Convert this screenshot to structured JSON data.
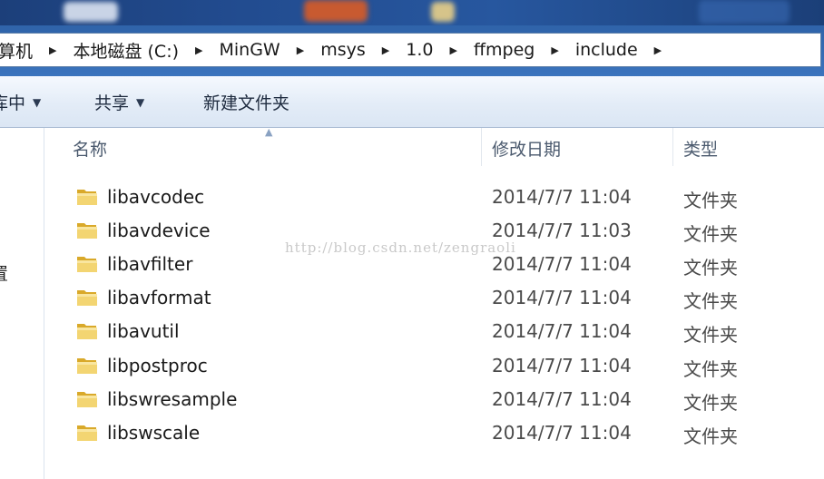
{
  "breadcrumb": {
    "items": [
      "算机",
      "本地磁盘 (C:)",
      "MinGW",
      "msys",
      "1.0",
      "ffmpeg",
      "include"
    ]
  },
  "toolbar": {
    "organize_label": "库中",
    "share_label": "共享",
    "new_folder_label": "新建文件夹"
  },
  "nav": {
    "partial_label": "置"
  },
  "columns": {
    "name": "名称",
    "date": "修改日期",
    "type": "类型"
  },
  "files": [
    {
      "name": "libavcodec",
      "date": "2014/7/7 11:04",
      "type": "文件夹"
    },
    {
      "name": "libavdevice",
      "date": "2014/7/7 11:03",
      "type": "文件夹"
    },
    {
      "name": "libavfilter",
      "date": "2014/7/7 11:04",
      "type": "文件夹"
    },
    {
      "name": "libavformat",
      "date": "2014/7/7 11:04",
      "type": "文件夹"
    },
    {
      "name": "libavutil",
      "date": "2014/7/7 11:04",
      "type": "文件夹"
    },
    {
      "name": "libpostproc",
      "date": "2014/7/7 11:04",
      "type": "文件夹"
    },
    {
      "name": "libswresample",
      "date": "2014/7/7 11:04",
      "type": "文件夹"
    },
    {
      "name": "libswscale",
      "date": "2014/7/7 11:04",
      "type": "文件夹"
    }
  ],
  "watermark": "http://blog.csdn.net/zengraoli",
  "colors": {
    "address_frame": "#2f63a9",
    "folder": "#e8c04a",
    "toolbar_bg": "#e3ecf7"
  }
}
